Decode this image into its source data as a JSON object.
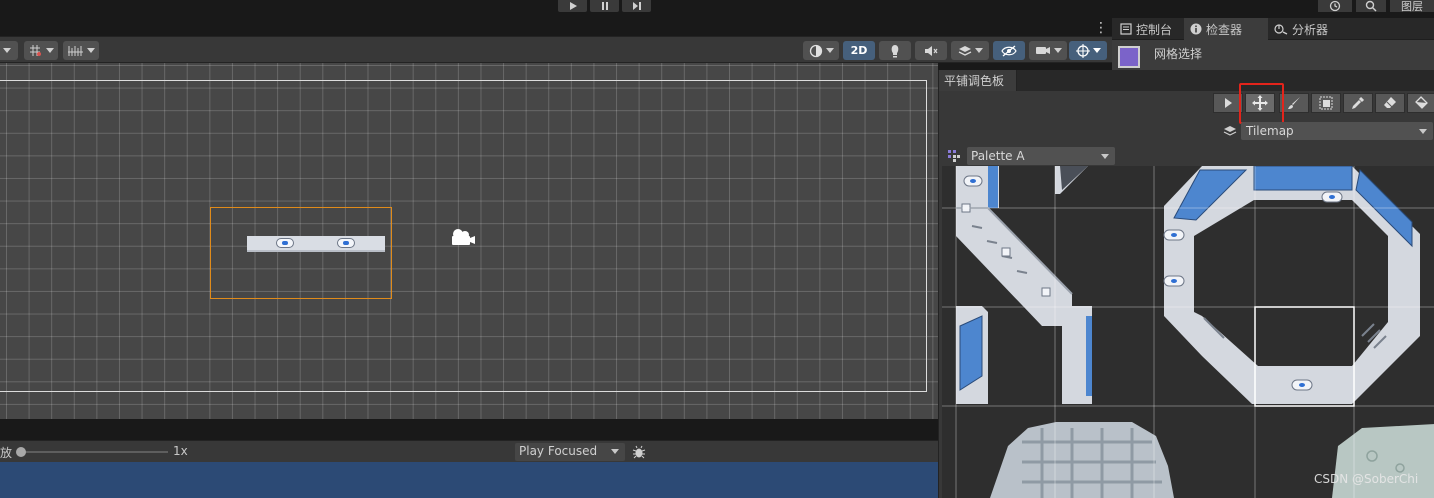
{
  "play_controls": {
    "buttons": [
      "play-icon",
      "pause-icon",
      "step-icon"
    ],
    "right_layers_label": "图层"
  },
  "scene_toolbar": {
    "left_tools": [
      "wireframe-icon",
      "grid-snap-icon",
      "increment-snap-icon"
    ],
    "right_tools": [
      "shading-mode-icon",
      "2D",
      "lighting-icon",
      "audio-icon",
      "effects-icon",
      "hidden-objects-icon",
      "camera-icon",
      "gizmos-icon"
    ],
    "mode_2d_label": "2D"
  },
  "game_toolbar": {
    "scale_label_fragment": "放",
    "scale_value": "1x",
    "play_focused_label": "Play Focused"
  },
  "right_panel": {
    "tabs": [
      {
        "label": "控制台",
        "icon": "console-icon"
      },
      {
        "label": "检查器",
        "icon": "info-icon"
      },
      {
        "label": "分析器",
        "icon": "profiler-icon"
      }
    ],
    "inspector_title": "网格选择"
  },
  "tile_palette": {
    "tab_label": "平铺调色板",
    "tools": [
      "select-icon",
      "move-icon",
      "brush-icon",
      "box-fill-icon",
      "picker-icon",
      "eraser-icon",
      "fill-icon"
    ],
    "selected_tool": "move-icon",
    "active_target": "Tilemap",
    "palette_name": "Palette A"
  },
  "watermark": "CSDN @SoberChi",
  "colors": {
    "scene_background": "#474747",
    "selection_outline": "#e08b1a",
    "highlight_box": "#e3241b",
    "game_view": "#2c4a75",
    "tile_blue": "#4d86cf"
  }
}
